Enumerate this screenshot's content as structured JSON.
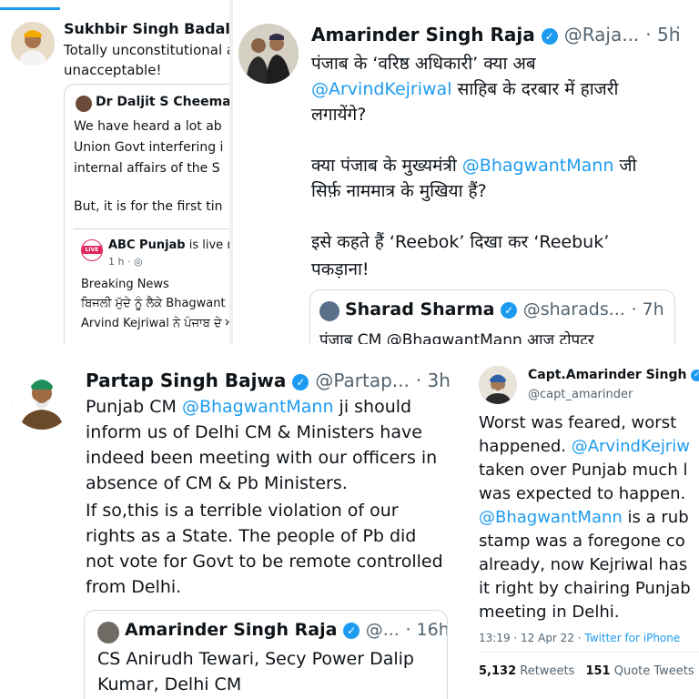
{
  "panel_tl": {
    "author": "Sukhbir Singh Badal",
    "handle_fragment": "@",
    "lines": [
      "Totally unconstitutional a",
      "unacceptable!"
    ],
    "quote": {
      "author": "Dr Daljit S Cheema",
      "lines": [
        "We have heard a lot ab",
        "Union Govt interfering i",
        "internal affairs of the S",
        "But, it is for the first tin"
      ],
      "inner": {
        "badge": "LIVE",
        "author": "ABC Punjab",
        "live_text": "is live n",
        "time": "1 h ·",
        "lines": [
          "Breaking News",
          "ਬਿਜਲੀ ਮੁੱਦੇ ਨੂੰ ਲੈਕੇ Bhagwant I",
          "Arvind Kejriwal ਨੇ ਪੰਜਾਬ ਦੇ ਅ"
        ]
      }
    }
  },
  "panel_tr": {
    "author": "Amarinder Singh Raja",
    "handle": "@Raja...",
    "time": "· 5h",
    "lines": [
      {
        "pre": "पंजाब के ‘वरिष्ठ अधिकारी’ क्या अब",
        "mention": "",
        "post": ""
      },
      {
        "pre": "",
        "mention": "@ArvindKejriwal",
        "post": " साहिब के दरबार में हाजरी"
      },
      {
        "pre": "लगायेंगे?",
        "mention": "",
        "post": ""
      },
      {
        "pre": "क्या पंजाब के मुख्यमंत्री ",
        "mention": "@BhagwantMann",
        "post": " जी"
      },
      {
        "pre": "सिर्फ़ नाममात्र के मुखिया हैं?",
        "mention": "",
        "post": ""
      },
      {
        "pre": "इसे कहते हैं ‘Reebok’ दिखा कर ‘Reebuk’",
        "mention": "",
        "post": ""
      },
      {
        "pre": "पकड़ाना!",
        "mention": "",
        "post": ""
      }
    ],
    "quote": {
      "author": "Sharad Sharma",
      "handle": "@sharads...",
      "time": "· 7h",
      "line": "पंजाब CM @BhagwantMann आज टोपटर"
    }
  },
  "panel_bl": {
    "author": "Partap Singh Bajwa",
    "handle": "@Partap...",
    "time": "· 3h",
    "lines": [
      {
        "pre": "Punjab CM ",
        "mention": "@BhagwantMann",
        "post": " ji should"
      },
      {
        "pre": "inform us of Delhi CM & Ministers have",
        "mention": "",
        "post": ""
      },
      {
        "pre": "indeed been meeting with our officers in",
        "mention": "",
        "post": ""
      },
      {
        "pre": "absence of CM & Pb Ministers.",
        "mention": "",
        "post": ""
      },
      {
        "pre": "If so,this is a terrible violation of our",
        "mention": "",
        "post": ""
      },
      {
        "pre": "rights as a State. The people of Pb did",
        "mention": "",
        "post": ""
      },
      {
        "pre": "not vote for Govt to be remote controlled",
        "mention": "",
        "post": ""
      },
      {
        "pre": "from Delhi.",
        "mention": "",
        "post": ""
      }
    ],
    "quote": {
      "author": "Amarinder Singh Raja",
      "handle": "@...",
      "time": "· 16h",
      "lines": [
        "CS Anirudh Tewari, Secy Power Dalip",
        "Kumar, Delhi CM"
      ]
    }
  },
  "panel_br": {
    "author": "Capt.Amarinder Singh",
    "handle": "@capt_amarinder",
    "lines": [
      {
        "pre": "Worst was feared, worst",
        "mention": "",
        "post": ""
      },
      {
        "pre": "happened. ",
        "mention": "@ArvindKejriw",
        "post": ""
      },
      {
        "pre": "taken over Punjab much l",
        "mention": "",
        "post": ""
      },
      {
        "pre": "was expected to happen.",
        "mention": "",
        "post": ""
      },
      {
        "pre": "",
        "mention": "@BhagwantMann",
        "post": " is a rub"
      },
      {
        "pre": "stamp was a foregone co",
        "mention": "",
        "post": ""
      },
      {
        "pre": "already, now Kejriwal has",
        "mention": "",
        "post": ""
      },
      {
        "pre": "it right by chairing Punjab",
        "mention": "",
        "post": ""
      },
      {
        "pre": "meeting in Delhi.",
        "mention": "",
        "post": ""
      }
    ],
    "timestamp": "13:19 · 12 Apr 22 · ",
    "source": "Twitter for iPhone",
    "retweets_count": "5,132",
    "retweets_label": "Retweets",
    "quotes_count": "151",
    "quotes_label": "Quote Tweets"
  },
  "colors": {
    "link": "#1d9bf0",
    "text": "#0f1419",
    "muted": "#536471",
    "verified": "#1d9bf0",
    "live_red": "#e0245e"
  }
}
